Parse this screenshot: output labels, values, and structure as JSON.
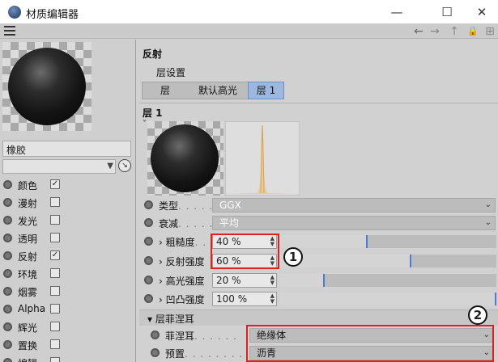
{
  "window": {
    "title": "材质编辑器",
    "min": "—",
    "max": "☐",
    "close": "✕"
  },
  "toolbar": {
    "back": "←",
    "forward": "→",
    "up": "↑",
    "lock": "🔒",
    "new": "⊞"
  },
  "left": {
    "material_name": "橡胶",
    "channels": [
      {
        "label": "颜色",
        "checked": true,
        "mark": "✓"
      },
      {
        "label": "漫射",
        "checked": false,
        "mark": ""
      },
      {
        "label": "发光",
        "checked": false,
        "mark": ""
      },
      {
        "label": "透明",
        "checked": false,
        "mark": ""
      },
      {
        "label": "反射",
        "checked": true,
        "mark": "✓"
      },
      {
        "label": "环境",
        "checked": false,
        "mark": ""
      },
      {
        "label": "烟雾",
        "checked": false,
        "mark": ""
      },
      {
        "label": "Alpha",
        "checked": false,
        "mark": ""
      },
      {
        "label": "辉光",
        "checked": false,
        "mark": ""
      },
      {
        "label": "置换",
        "checked": false,
        "mark": ""
      },
      {
        "label": "编辑",
        "checked": false,
        "mark": ""
      }
    ]
  },
  "right": {
    "section_title": "反射",
    "layer_settings_label": "层设置",
    "tabs": [
      "层",
      "默认高光",
      "层 1"
    ],
    "layer_title": "层 1",
    "collapse": "˅",
    "type": {
      "label": "类型",
      "dots": ". . . . . .",
      "value": "GGX"
    },
    "attenuation": {
      "label": "衰减",
      "dots": ". . . . . .",
      "value": "平均"
    },
    "roughness": {
      "label": "› 粗糙度",
      "dots": ". . .",
      "value": "40 %",
      "level": 0.4
    },
    "reflection_strength": {
      "label": "› 反射强度",
      "value": "60 %",
      "level": 0.6
    },
    "specular_strength": {
      "label": "› 高光强度",
      "value": "20 %",
      "level": 0.2
    },
    "bump_strength": {
      "label": "› 凹凸强度",
      "value": "100 %",
      "level": 1.0
    },
    "fresnel_header": "▾ 层菲涅耳",
    "fresnel": {
      "label": "菲涅耳",
      "dots": ". . . . . .",
      "value": "绝缘体"
    },
    "preset": {
      "label": "预置",
      "dots": ". . . . . . . .",
      "value": "沥青"
    }
  },
  "callouts": [
    "1",
    "2"
  ],
  "colors": {
    "accent": "#4d7dd0",
    "highlight_box": "#e02020",
    "tab_active": "#9db8df"
  }
}
